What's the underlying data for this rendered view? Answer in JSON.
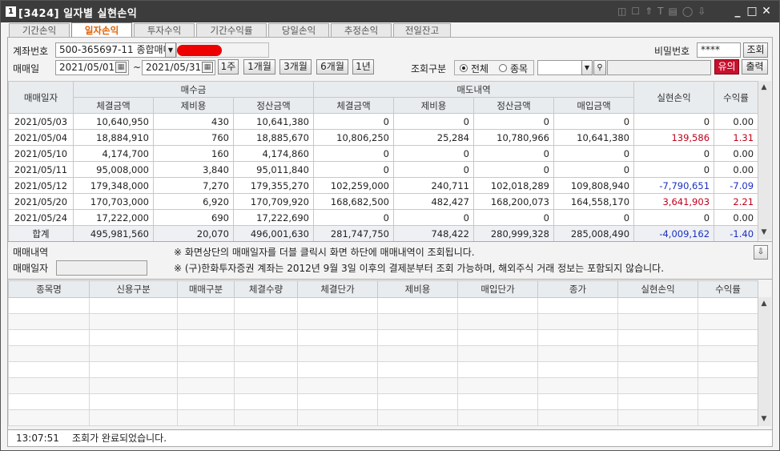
{
  "window": {
    "icon_text": "1",
    "title": "[3424] 일자별 실현손익"
  },
  "tabs": [
    "기간손익",
    "일자손익",
    "투자수익",
    "기간수익률",
    "당일손익",
    "추정손익",
    "전일잔고"
  ],
  "active_tab": "일자손익",
  "form": {
    "account_label": "계좌번호",
    "account_value": "500-365697-11 종합매매",
    "password_label": "비밀번호",
    "password_value": "****",
    "query_button": "조회",
    "date_label": "매매일",
    "date_from": "2021/05/01",
    "date_sep": "~",
    "date_to": "2021/05/31",
    "range_buttons": [
      "1주",
      "1개월",
      "3개월",
      "6개월",
      "1년"
    ],
    "query_type_label": "조회구분",
    "radio_all": "전체",
    "radio_stock": "종목",
    "notice_button": "유의",
    "print_button": "출력"
  },
  "main_table": {
    "h_date": "매매일자",
    "h_buy_group": "매수금",
    "h_sell_group": "매도내역",
    "h_realized": "실현손익",
    "h_return": "수익률",
    "sub": [
      "체결금액",
      "제비용",
      "정산금액",
      "체결금액",
      "제비용",
      "정산금액",
      "매입금액"
    ],
    "rows": [
      {
        "date": "2021/05/03",
        "vals": [
          "10,640,950",
          "430",
          "10,641,380",
          "0",
          "0",
          "0",
          "0"
        ],
        "realized": "0",
        "return": "0.00",
        "sign": "zero"
      },
      {
        "date": "2021/05/04",
        "vals": [
          "18,884,910",
          "760",
          "18,885,670",
          "10,806,250",
          "25,284",
          "10,780,966",
          "10,641,380"
        ],
        "realized": "139,586",
        "return": "1.31",
        "sign": "pos"
      },
      {
        "date": "2021/05/10",
        "vals": [
          "4,174,700",
          "160",
          "4,174,860",
          "0",
          "0",
          "0",
          "0"
        ],
        "realized": "0",
        "return": "0.00",
        "sign": "zero"
      },
      {
        "date": "2021/05/11",
        "vals": [
          "95,008,000",
          "3,840",
          "95,011,840",
          "0",
          "0",
          "0",
          "0"
        ],
        "realized": "0",
        "return": "0.00",
        "sign": "zero"
      },
      {
        "date": "2021/05/12",
        "vals": [
          "179,348,000",
          "7,270",
          "179,355,270",
          "102,259,000",
          "240,711",
          "102,018,289",
          "109,808,940"
        ],
        "realized": "-7,790,651",
        "return": "-7.09",
        "sign": "neg"
      },
      {
        "date": "2021/05/20",
        "vals": [
          "170,703,000",
          "6,920",
          "170,709,920",
          "168,682,500",
          "482,427",
          "168,200,073",
          "164,558,170"
        ],
        "realized": "3,641,903",
        "return": "2.21",
        "sign": "pos"
      },
      {
        "date": "2021/05/24",
        "vals": [
          "17,222,000",
          "690",
          "17,222,690",
          "0",
          "0",
          "0",
          "0"
        ],
        "realized": "0",
        "return": "0.00",
        "sign": "zero"
      }
    ],
    "total": {
      "label": "합계",
      "vals": [
        "495,981,560",
        "20,070",
        "496,001,630",
        "281,747,750",
        "748,422",
        "280,999,328",
        "285,008,490"
      ],
      "realized": "-4,009,162",
      "return": "-1.40",
      "sign": "neg"
    }
  },
  "detail": {
    "trade_label": "매매내역",
    "date_label": "매매일자",
    "date_value": "",
    "note1": "※ 화면상단의 매매일자를 더블 클릭시 화면 하단에 매매내역이 조회됩니다.",
    "note2": "※ (구)한화투자증권 계좌는 2012년 9월 3일 이후의 결제분부터 조회 가능하며, 해외주식 거래 정보는 포함되지 않습니다."
  },
  "detail_table": {
    "headers": [
      "종목명",
      "신용구분",
      "매매구분",
      "체결수량",
      "체결단가",
      "제비용",
      "매입단가",
      "종가",
      "실현손익",
      "수익률"
    ]
  },
  "status": {
    "time": "13:07:51",
    "message": "조회가 완료되었습니다."
  }
}
